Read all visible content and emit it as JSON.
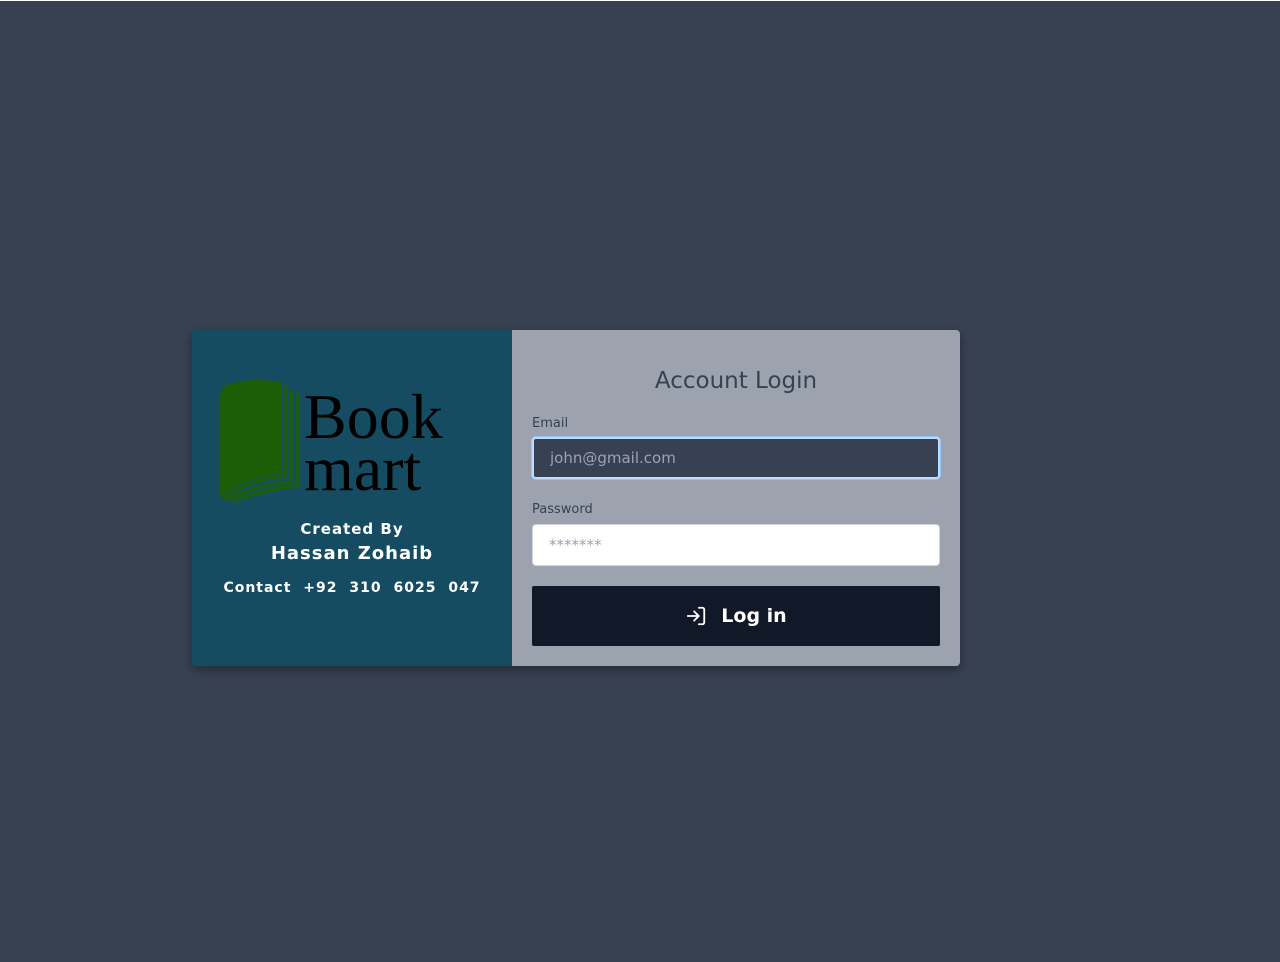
{
  "brand": {
    "logo_line1": "Book",
    "logo_line2": "mart",
    "logo_color": "#1b5e06",
    "created_by_label": "Created By",
    "author": "Hassan Zohaib",
    "contact": "Contact  +92 310 6025 047"
  },
  "login": {
    "title": "Account Login",
    "email": {
      "label": "Email",
      "placeholder": "john@gmail.com",
      "value": ""
    },
    "password": {
      "label": "Password",
      "placeholder": "*******",
      "value": ""
    },
    "submit": {
      "label": "Log in",
      "icon": "login-icon"
    }
  },
  "colors": {
    "page_background": "#384152",
    "brand_panel": "#164c62",
    "form_panel": "#9ca3af",
    "button": "#111827",
    "focus_ring": "#bfdbfe"
  }
}
